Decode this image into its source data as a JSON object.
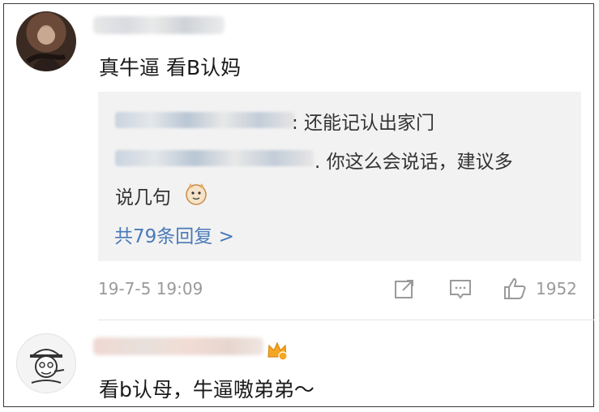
{
  "comments": [
    {
      "text": "真牛逼  看B认妈",
      "replies": [
        {
          "text": ": 还能记认出家门"
        },
        {
          "text_line1": ". 你这么会说话，建议多",
          "text_line2": "说几句"
        }
      ],
      "more_replies": "共79条回复 >",
      "timestamp": "19-7-5 19:09",
      "likes": "1952"
    },
    {
      "text": "看b认母，牛逼嗷弟弟～"
    }
  ],
  "icons": {
    "share": "share-icon",
    "comment": "comment-icon",
    "like": "like-icon",
    "emoji": "cat-emoji-icon",
    "badge": "crown-badge-icon"
  },
  "colors": {
    "link": "#4a7ab8",
    "meta": "#9a9a9a",
    "reply_bg": "#f2f2f2",
    "badge": "#f5a623"
  }
}
